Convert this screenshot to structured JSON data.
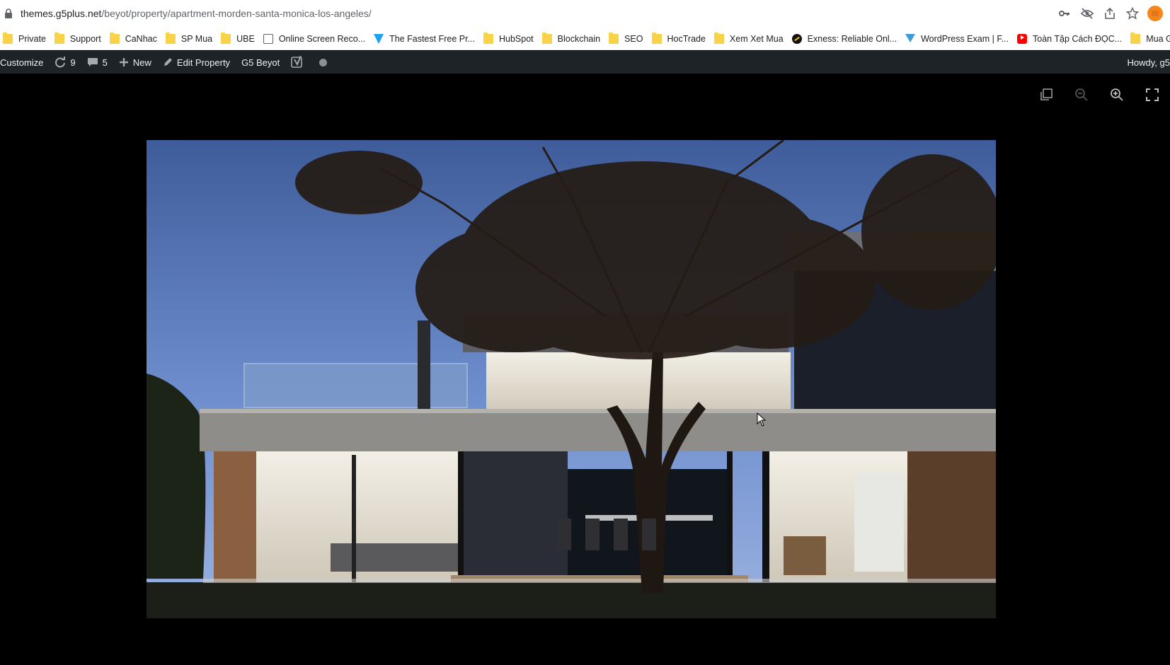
{
  "browser": {
    "url_host": "themes.g5plus.net",
    "url_path": "/beyot/property/apartment-morden-santa-monica-los-angeles/",
    "icons": [
      "key-icon",
      "eye-off-icon",
      "share-icon",
      "star-icon",
      "metamask-fox-icon"
    ]
  },
  "bookmarks": [
    {
      "label": "Private",
      "icon": "folder"
    },
    {
      "label": "Support",
      "icon": "folder"
    },
    {
      "label": "CaNhac",
      "icon": "folder"
    },
    {
      "label": "SP Mua",
      "icon": "folder"
    },
    {
      "label": "UBE",
      "icon": "folder"
    },
    {
      "label": "Online Screen Reco...",
      "icon": "monitor"
    },
    {
      "label": "The Fastest Free Pr...",
      "icon": "vtri"
    },
    {
      "label": "HubSpot",
      "icon": "folder"
    },
    {
      "label": "Blockchain",
      "icon": "folder"
    },
    {
      "label": "SEO",
      "icon": "folder"
    },
    {
      "label": "HocTrade",
      "icon": "folder"
    },
    {
      "label": "Xem Xet Mua",
      "icon": "folder"
    },
    {
      "label": "Exness: Reliable Onl...",
      "icon": "exness"
    },
    {
      "label": "WordPress Exam | F...",
      "icon": "wp"
    },
    {
      "label": "Toàn Tập Cách ĐỌC...",
      "icon": "yt"
    },
    {
      "label": "Mua G",
      "icon": "folder"
    }
  ],
  "adminbar": {
    "customize": "Customize",
    "updates_count": "9",
    "comments_count": "5",
    "new_label": "New",
    "edit_label": "Edit Property",
    "site_label": "G5 Beyot",
    "howdy": "Howdy, g5"
  },
  "lightbox": {
    "tools": [
      "copy-icon",
      "zoom-out-icon",
      "zoom-in-icon",
      "fullscreen-icon"
    ]
  }
}
